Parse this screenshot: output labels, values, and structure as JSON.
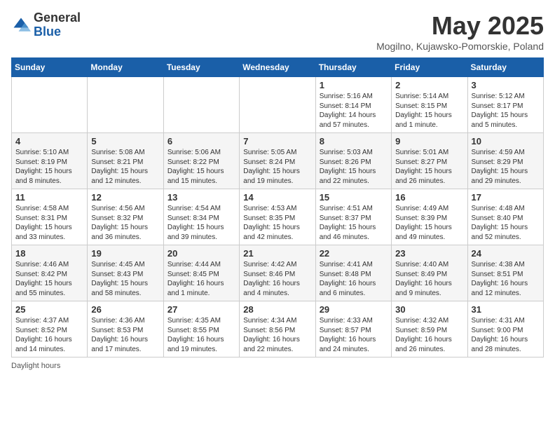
{
  "header": {
    "logo_general": "General",
    "logo_blue": "Blue",
    "title": "May 2025",
    "subtitle": "Mogilno, Kujawsko-Pomorskie, Poland"
  },
  "days_of_week": [
    "Sunday",
    "Monday",
    "Tuesday",
    "Wednesday",
    "Thursday",
    "Friday",
    "Saturday"
  ],
  "weeks": [
    [
      {
        "day": "",
        "info": ""
      },
      {
        "day": "",
        "info": ""
      },
      {
        "day": "",
        "info": ""
      },
      {
        "day": "",
        "info": ""
      },
      {
        "day": "1",
        "info": "Sunrise: 5:16 AM\nSunset: 8:14 PM\nDaylight: 14 hours and 57 minutes."
      },
      {
        "day": "2",
        "info": "Sunrise: 5:14 AM\nSunset: 8:15 PM\nDaylight: 15 hours and 1 minute."
      },
      {
        "day": "3",
        "info": "Sunrise: 5:12 AM\nSunset: 8:17 PM\nDaylight: 15 hours and 5 minutes."
      }
    ],
    [
      {
        "day": "4",
        "info": "Sunrise: 5:10 AM\nSunset: 8:19 PM\nDaylight: 15 hours and 8 minutes."
      },
      {
        "day": "5",
        "info": "Sunrise: 5:08 AM\nSunset: 8:21 PM\nDaylight: 15 hours and 12 minutes."
      },
      {
        "day": "6",
        "info": "Sunrise: 5:06 AM\nSunset: 8:22 PM\nDaylight: 15 hours and 15 minutes."
      },
      {
        "day": "7",
        "info": "Sunrise: 5:05 AM\nSunset: 8:24 PM\nDaylight: 15 hours and 19 minutes."
      },
      {
        "day": "8",
        "info": "Sunrise: 5:03 AM\nSunset: 8:26 PM\nDaylight: 15 hours and 22 minutes."
      },
      {
        "day": "9",
        "info": "Sunrise: 5:01 AM\nSunset: 8:27 PM\nDaylight: 15 hours and 26 minutes."
      },
      {
        "day": "10",
        "info": "Sunrise: 4:59 AM\nSunset: 8:29 PM\nDaylight: 15 hours and 29 minutes."
      }
    ],
    [
      {
        "day": "11",
        "info": "Sunrise: 4:58 AM\nSunset: 8:31 PM\nDaylight: 15 hours and 33 minutes."
      },
      {
        "day": "12",
        "info": "Sunrise: 4:56 AM\nSunset: 8:32 PM\nDaylight: 15 hours and 36 minutes."
      },
      {
        "day": "13",
        "info": "Sunrise: 4:54 AM\nSunset: 8:34 PM\nDaylight: 15 hours and 39 minutes."
      },
      {
        "day": "14",
        "info": "Sunrise: 4:53 AM\nSunset: 8:35 PM\nDaylight: 15 hours and 42 minutes."
      },
      {
        "day": "15",
        "info": "Sunrise: 4:51 AM\nSunset: 8:37 PM\nDaylight: 15 hours and 46 minutes."
      },
      {
        "day": "16",
        "info": "Sunrise: 4:49 AM\nSunset: 8:39 PM\nDaylight: 15 hours and 49 minutes."
      },
      {
        "day": "17",
        "info": "Sunrise: 4:48 AM\nSunset: 8:40 PM\nDaylight: 15 hours and 52 minutes."
      }
    ],
    [
      {
        "day": "18",
        "info": "Sunrise: 4:46 AM\nSunset: 8:42 PM\nDaylight: 15 hours and 55 minutes."
      },
      {
        "day": "19",
        "info": "Sunrise: 4:45 AM\nSunset: 8:43 PM\nDaylight: 15 hours and 58 minutes."
      },
      {
        "day": "20",
        "info": "Sunrise: 4:44 AM\nSunset: 8:45 PM\nDaylight: 16 hours and 1 minute."
      },
      {
        "day": "21",
        "info": "Sunrise: 4:42 AM\nSunset: 8:46 PM\nDaylight: 16 hours and 4 minutes."
      },
      {
        "day": "22",
        "info": "Sunrise: 4:41 AM\nSunset: 8:48 PM\nDaylight: 16 hours and 6 minutes."
      },
      {
        "day": "23",
        "info": "Sunrise: 4:40 AM\nSunset: 8:49 PM\nDaylight: 16 hours and 9 minutes."
      },
      {
        "day": "24",
        "info": "Sunrise: 4:38 AM\nSunset: 8:51 PM\nDaylight: 16 hours and 12 minutes."
      }
    ],
    [
      {
        "day": "25",
        "info": "Sunrise: 4:37 AM\nSunset: 8:52 PM\nDaylight: 16 hours and 14 minutes."
      },
      {
        "day": "26",
        "info": "Sunrise: 4:36 AM\nSunset: 8:53 PM\nDaylight: 16 hours and 17 minutes."
      },
      {
        "day": "27",
        "info": "Sunrise: 4:35 AM\nSunset: 8:55 PM\nDaylight: 16 hours and 19 minutes."
      },
      {
        "day": "28",
        "info": "Sunrise: 4:34 AM\nSunset: 8:56 PM\nDaylight: 16 hours and 22 minutes."
      },
      {
        "day": "29",
        "info": "Sunrise: 4:33 AM\nSunset: 8:57 PM\nDaylight: 16 hours and 24 minutes."
      },
      {
        "day": "30",
        "info": "Sunrise: 4:32 AM\nSunset: 8:59 PM\nDaylight: 16 hours and 26 minutes."
      },
      {
        "day": "31",
        "info": "Sunrise: 4:31 AM\nSunset: 9:00 PM\nDaylight: 16 hours and 28 minutes."
      }
    ]
  ],
  "footer": {
    "daylight_hours_label": "Daylight hours"
  }
}
